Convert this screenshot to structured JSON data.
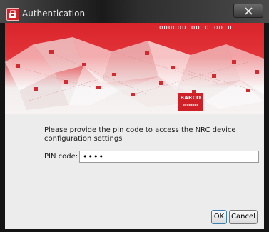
{
  "window": {
    "title": "Authentication",
    "app_icon": "barco-app-icon",
    "close_icon": "close-icon"
  },
  "banner": {
    "pixel_text": "oooooo oo o oo o",
    "logo_text": "BARCO",
    "logo_subtext": "▪▪▪▪▪▪▪▪",
    "colors": {
      "brand_red": "#d9242b",
      "light": "#f7f3f3"
    }
  },
  "form": {
    "message": "Please provide the pin code to access the NRC device configuration settings",
    "pin_label": "PIN code:",
    "pin_value": "••••"
  },
  "buttons": {
    "ok_label": "OK",
    "cancel_label": "Cancel"
  }
}
